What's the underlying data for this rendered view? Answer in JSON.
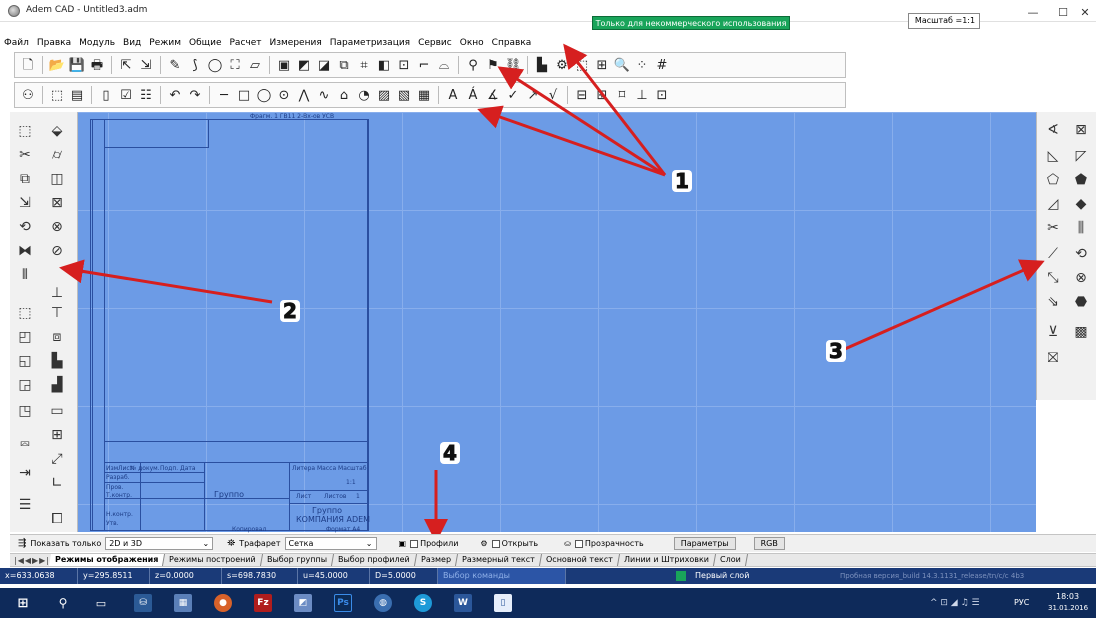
{
  "window": {
    "title": "Adem CAD - Untitled3.adm",
    "noncommercial": "Только для некоммерческого использования !",
    "scale_label": "Масштаб =1:1",
    "min_glyph": "—",
    "max_glyph": "☐",
    "close_glyph": "✕"
  },
  "menu": [
    "Файл",
    "Правка",
    "Модуль",
    "Вид",
    "Режим",
    "Общие",
    "Расчет",
    "Измерения",
    "Параметризация",
    "Сервис",
    "Окно",
    "Справка"
  ],
  "callouts": {
    "c1": "1",
    "c2": "2",
    "c3": "3",
    "c4": "4"
  },
  "sheet": {
    "format_text": "Фрагм. 1   ГВ11 2-Вх-ов     УСВ",
    "tb_cells": [
      "Изм",
      "Лист",
      "№ докум.",
      "Подп.",
      "Дата"
    ],
    "tb_roles": [
      "Разраб.",
      "Пров.",
      "Т.контр.",
      "Н.контр.",
      "Утв."
    ],
    "lit_header": "Литера  Масса  Масштаб",
    "scale_val": "1:1",
    "sheet_label": "Лист",
    "sheets_label": "Листов",
    "sheets_val": "1",
    "group_text": "Группо",
    "company_text": "КОМПАНИЯ АDЕМ",
    "copied_label": "Копировал",
    "format_label": "Формат А4"
  },
  "bottom": {
    "show_only_label": "Показать только",
    "show_only_value": "2D и 3D",
    "stencil_label": "Трафарет",
    "stencil_value": "Сетка",
    "profiles_label": "Профили",
    "open_label": "Открыть",
    "transparency_label": "Прозрачность",
    "params_button": "Параметры",
    "rgb_button": "RGB"
  },
  "tabs": [
    {
      "label": "Режимы отображения",
      "active": true
    },
    {
      "label": "Режимы построений",
      "active": false
    },
    {
      "label": "Выбор группы",
      "active": false
    },
    {
      "label": "Выбор профилей",
      "active": false
    },
    {
      "label": "Размер",
      "active": false
    },
    {
      "label": "Размерный текст",
      "active": false
    },
    {
      "label": "Основной текст",
      "active": false
    },
    {
      "label": "Линии и Штриховки",
      "active": false
    },
    {
      "label": "Слои",
      "active": false
    }
  ],
  "status": {
    "x": "x=633.0638",
    "y": "y=295.8511",
    "z": "z=0.0000",
    "s": "s=698.7830",
    "u": "u=45.0000",
    "d": "D=5.0000",
    "command": "Выбор команды",
    "layer": "Первый слой",
    "trial": "Пробная версия_build 14.3.1131_release/tn/c/c 4b3"
  },
  "taskbar": {
    "clock_time": "18:03",
    "clock_date": "31.01.2016",
    "lang": "РУС"
  },
  "colors": {
    "accent": "#6c9be6",
    "badge": "#19a45a",
    "arrow": "#d61f1f",
    "status_bg": "#1a3a78"
  }
}
